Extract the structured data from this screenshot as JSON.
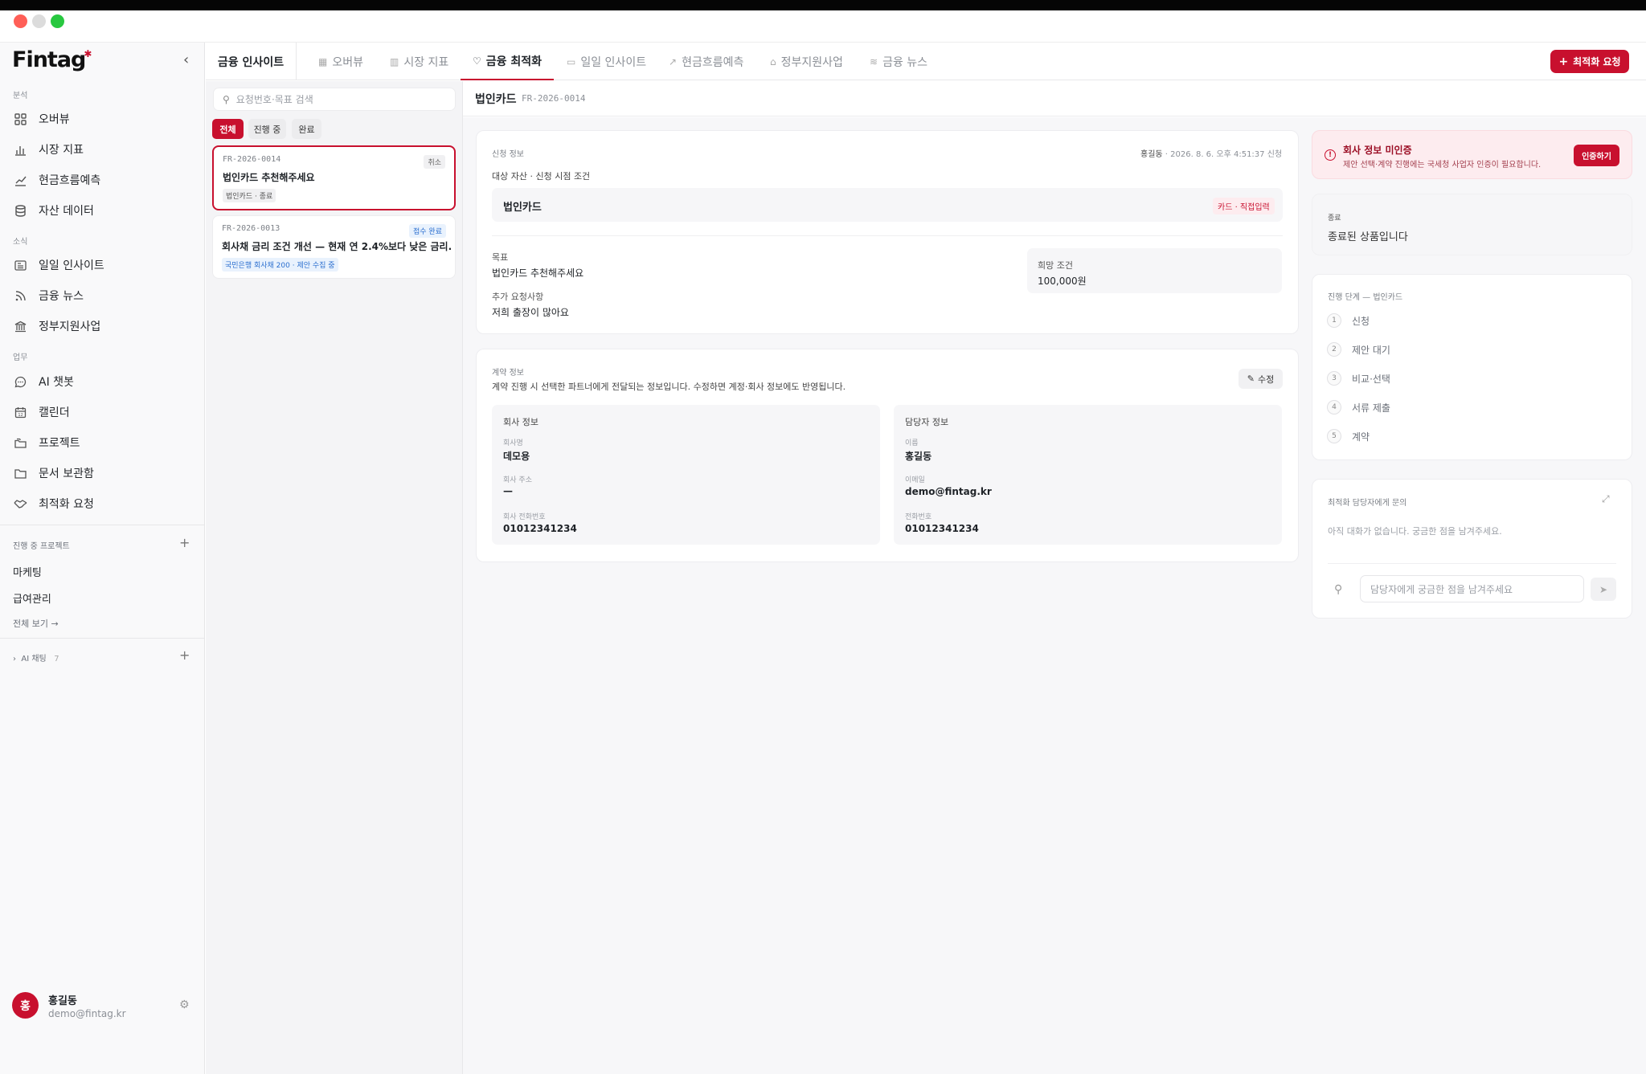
{
  "app": {
    "logo": "Fintag",
    "logo_mark": "✱"
  },
  "sidebar": {
    "sections": [
      {
        "label": "분석"
      },
      {
        "label": "소식"
      },
      {
        "label": "업무"
      }
    ],
    "items": [
      {
        "label": "오버뷰",
        "icon": "grid-icon"
      },
      {
        "label": "시장 지표",
        "icon": "bar-chart-icon"
      },
      {
        "label": "현금흐름예측",
        "icon": "trend-icon"
      },
      {
        "label": "자산 데이터",
        "icon": "database-icon"
      },
      {
        "label": "일일 인사이트",
        "icon": "newspaper-icon"
      },
      {
        "label": "금융 뉴스",
        "icon": "rss-icon"
      },
      {
        "label": "정부지원사업",
        "icon": "bank-icon"
      },
      {
        "label": "AI 챗봇",
        "icon": "chat-icon"
      },
      {
        "label": "캘린더",
        "icon": "calendar-icon"
      },
      {
        "label": "프로젝트",
        "icon": "folders-icon"
      },
      {
        "label": "문서 보관함",
        "icon": "folder-icon"
      },
      {
        "label": "최적화 요청",
        "icon": "handshake-icon"
      }
    ],
    "projects_label": "진행 중 프로젝트",
    "projects": [
      "마케팅",
      "급여관리"
    ],
    "view_all": "전체 보기 →",
    "ai_chat": {
      "label": "AI 채팅",
      "count": "7"
    },
    "user": {
      "initial": "홍",
      "name": "홍길동",
      "email": "demo@fintag.kr"
    }
  },
  "tabs": {
    "main": "금융 인사이트",
    "items": [
      {
        "label": "오버뷰"
      },
      {
        "label": "시장 지표"
      },
      {
        "label": "금융 최적화"
      },
      {
        "label": "일일 인사이트"
      },
      {
        "label": "현금흐름예측"
      },
      {
        "label": "정부지원사업"
      },
      {
        "label": "금융 뉴스"
      }
    ],
    "active": "금융 최적화",
    "request_button": "최적화 요청"
  },
  "list": {
    "search_placeholder": "요청번호·목표 검색",
    "filters": [
      "전체",
      "진행 중",
      "완료"
    ],
    "cards": [
      {
        "id": "FR-2026-0014",
        "title": "법인카드 추천해주세요",
        "tag": "법인카드 · 종료",
        "badge": "취소"
      },
      {
        "id": "FR-2026-0013",
        "title": "회사채 금리 조건 개선 — 현재 연 2.4%보다 낮은 금리...",
        "tag": "국민은행 회사채 200 · 제안 수집 중",
        "badge": "접수 완료"
      }
    ]
  },
  "detail": {
    "title": "법인카드",
    "id": "FR-2026-0014",
    "application": {
      "label": "신청 정보",
      "meta_name": "홍길동",
      "meta_date": " · 2026. 8. 6. 오후 4:51:37 신청",
      "target_label": "대상 자산 · 신청 시점 조건",
      "asset_name": "법인카드",
      "asset_tag": "카드 · 직접입력",
      "goal_label": "목표",
      "goal": "법인카드 추천해주세요",
      "extra_label": "추가 요청사항",
      "extra": "저희 출장이 많아요",
      "wish_label": "희망 조건",
      "wish": "100,000원"
    },
    "contract": {
      "label": "계약 정보",
      "desc": "계약 진행 시 선택한 파트너에게 전달되는 정보입니다. 수정하면 계정·회사 정보에도 반영됩니다.",
      "edit": "수정",
      "company": {
        "title": "회사 정보",
        "name_label": "회사명",
        "name": "데모용",
        "addr_label": "회사 주소",
        "addr": "—",
        "phone_label": "회사 전화번호",
        "phone": "01012341234"
      },
      "manager": {
        "title": "담당자 정보",
        "name_label": "이름",
        "name": "홍길동",
        "email_label": "이메일",
        "email": "demo@fintag.kr",
        "phone_label": "전화번호",
        "phone": "01012341234"
      }
    }
  },
  "right": {
    "alert": {
      "title": "회사 정보 미인증",
      "desc": "제안 선택·계약 진행에는 국세청 사업자 인증이 필요합니다.",
      "button": "인증하기"
    },
    "status": {
      "label": "종료",
      "text": "종료된 상품입니다"
    },
    "steps": {
      "label": "진행 단계 — 법인카드",
      "items": [
        {
          "n": "1",
          "label": "신청"
        },
        {
          "n": "2",
          "label": "제안 대기"
        },
        {
          "n": "3",
          "label": "비교·선택"
        },
        {
          "n": "4",
          "label": "서류 제출"
        },
        {
          "n": "5",
          "label": "계약"
        }
      ]
    },
    "chat": {
      "label": "최적화 담당자에게 문의",
      "empty": "아직 대화가 없습니다. 궁금한 점을 남겨주세요.",
      "placeholder": "담당자에게 궁금한 점을 남겨주세요"
    }
  }
}
